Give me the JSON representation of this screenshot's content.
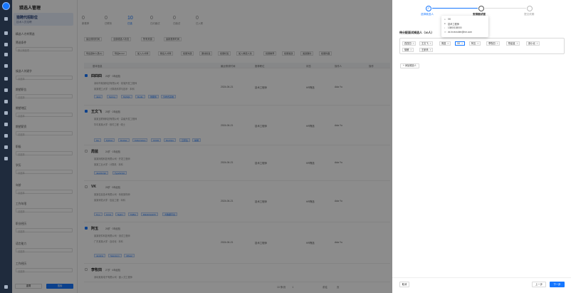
{
  "app": {
    "title": "猎选人管理"
  },
  "sidebar": {
    "position_title": "猎聘代招职位",
    "position_sub": "技术人员招聘",
    "filter_label": "精选人才库筛选",
    "quick_filter": "筛选条件",
    "quick_filter_value": "默认筛选项",
    "sections": [
      "候选人关键字",
      "期望职位",
      "期望地区",
      "期望薪资",
      "职级",
      "学历",
      "年龄",
      "年龄区间",
      "工作年限",
      "职业经历",
      "语言能力",
      "工作经历"
    ],
    "placeholder": "请选择",
    "reset_label": "重置",
    "search_label": "搜索"
  },
  "main": {
    "tabs": [
      {
        "num": "0",
        "label": "新推荐"
      },
      {
        "num": "0",
        "label": "已联系"
      },
      {
        "num": "10",
        "label": "已选"
      },
      {
        "num": "0",
        "label": "已约面试"
      },
      {
        "num": "0",
        "label": "已面试"
      },
      {
        "num": "0",
        "label": "已入职"
      }
    ],
    "chips": [
      "最近修改时间",
      "全部候选人状态",
      "所有来源",
      "最新推荐时间"
    ],
    "tools": [
      "导出选中人员(1)",
      "导出Excel",
      "加入人才库",
      "移出人才库",
      "批量沟通",
      "邀请投递",
      "批量标签",
      "加入候选人池",
      "批量推荐",
      "批量发送",
      "发送邀约",
      "批量约面"
    ],
    "headers": [
      "基本信息",
      "最近修改时间",
      "推荐职位",
      "状态",
      "操作人",
      "操作"
    ],
    "rows": [
      {
        "name": "四四四",
        "meta": "26岁 · 3年经验",
        "line1": "深圳市某某科技有限公司 · 前端开发工程师",
        "line2": "某某理工大学 · 计算机科学与技术 · 本科",
        "date": "2024-06-21",
        "role": "技术工程师",
        "status": "HR筛选",
        "owner": "Ada Yu",
        "tags": [
          "Java",
          "Spring",
          "MySQL",
          "Redis",
          "微服务",
          "分布式系统"
        ],
        "checked": true
      },
      {
        "name": "王文飞",
        "meta": "25岁 · 2年经验",
        "line1": "某某互联网科技有限公司 · 高级开发工程师",
        "line2": "华中某某大学 · 软件工程 · 硕士",
        "date": "2024-06-21",
        "role": "技术工程师",
        "status": "HR筛选",
        "owner": "Ada Yu",
        "tags": [
          "Go",
          "Python",
          "Docker",
          "Kubernetes",
          "CI/CD",
          "DevOps",
          "云原生",
          "前端"
        ],
        "checked": true
      },
      {
        "name": "周蓝",
        "meta": "24岁 · 1年经验",
        "line1": "某某网络科技有限公司 · 开发工程师",
        "line2": "某某工业大学 · 计算机 · 本科",
        "date": "2024-06-21",
        "role": "技术工程师",
        "status": "HR筛选",
        "owner": "Ada Yu",
        "tags": [
          "JavaScript",
          "TypeScript"
        ],
        "checked": false
      },
      {
        "name": "VK",
        "meta": "28岁 · 5年经验",
        "line1": "某某信息技术有限公司 · 系统架构师",
        "line2": "某某师范大学 · 信息工程 · 本科",
        "date": "2024-06-21",
        "role": "技术工程师",
        "status": "HR筛选",
        "owner": "Ada Yu",
        "tags": [
          "C++",
          "Linux",
          "Nginx",
          "Kafka",
          "Elasticsearch",
          "大数据平台"
        ],
        "checked": false
      },
      {
        "name": "阿玉",
        "meta": "26岁 · 3年经验",
        "line1": "某某软件科技有限公司 · 测试工程师",
        "line2": "广东某某大学 · 自动化 · 本科",
        "date": "2024-06-21",
        "role": "技术工程师",
        "status": "HR筛选",
        "owner": "Ada Yu",
        "tags": [
          "Jenkins",
          "Selenium",
          "JMeter"
        ],
        "checked": true
      },
      {
        "name": "李牧田",
        "meta": "27岁 · 4年经验",
        "line1": "深圳某某电子有限公司 · 嵌入式工程师",
        "line2": "某某科技大学 · 电子信息 · 本科",
        "date": "",
        "role": "",
        "status": "",
        "owner": "",
        "tags": [],
        "checked": false
      }
    ],
    "pager": {
      "size": "10 条/页",
      "page": "1",
      "goto": "前往",
      "unit": "页"
    }
  },
  "panel": {
    "steps": [
      {
        "label": "选择候选人",
        "state": "done"
      },
      {
        "label": "安排面试官",
        "state": "current"
      },
      {
        "label": "提交改期",
        "state": "todo"
      }
    ],
    "select_title": "待分配面试候选人（10人）",
    "candidates": [
      "四四四",
      "王文飞",
      "周蓝",
      "VK",
      "阿玉",
      "李牧田",
      "陈星星",
      "张小北",
      "徐朗",
      "王家禾"
    ],
    "add_label": "+ 添加候选人",
    "popover": {
      "name": "VK",
      "role": "技术工程师",
      "phone": "13800138000",
      "email": "vk.hr.recruiter@hm.com"
    },
    "back_label": "取消",
    "prev_label": "上一步",
    "next_label": "下一步"
  },
  "colors": {
    "accent": "#1677ff",
    "rail": "#1f2b3d"
  }
}
